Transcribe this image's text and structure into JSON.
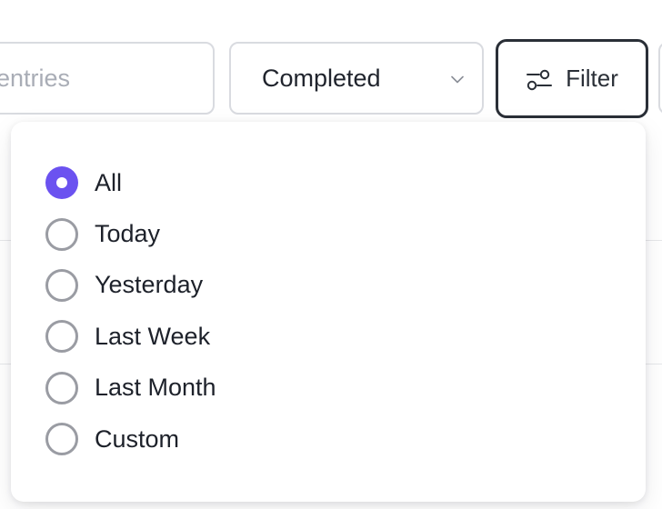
{
  "search": {
    "placeholder": "entries"
  },
  "status_filter": {
    "selected": "Completed",
    "icon": "chevron-down-icon"
  },
  "filter_button": {
    "label": "Filter",
    "icon": "sliders-icon"
  },
  "date_filter": {
    "selected_index": 0,
    "options": [
      {
        "label": "All",
        "selected": true
      },
      {
        "label": "Today",
        "selected": false
      },
      {
        "label": "Yesterday",
        "selected": false
      },
      {
        "label": "Last Week",
        "selected": false
      },
      {
        "label": "Last Month",
        "selected": false
      },
      {
        "label": "Custom",
        "selected": false
      }
    ]
  },
  "colors": {
    "accent": "#6b52f0",
    "border": "#d9dbe0",
    "active_border": "#2a2f37",
    "radio_border": "#9a9ca3",
    "placeholder": "#a9adb6"
  }
}
